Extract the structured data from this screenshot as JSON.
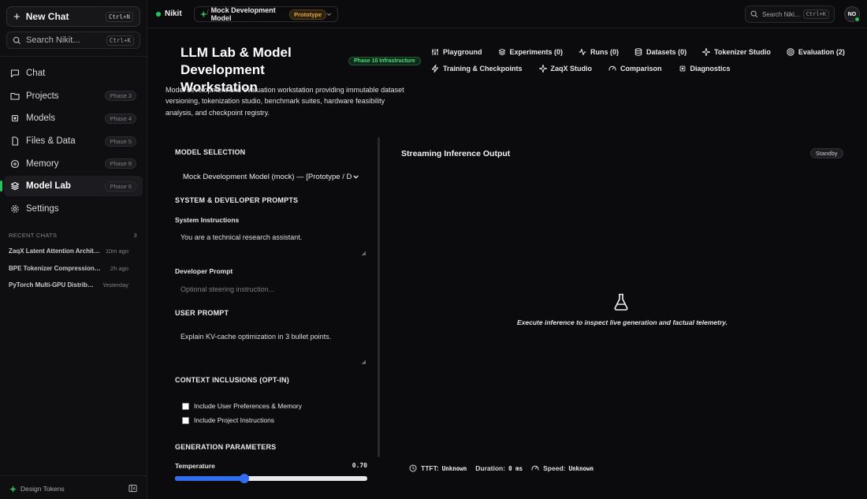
{
  "sidebar": {
    "new_chat": "New Chat",
    "new_chat_kbd": "Ctrl+N",
    "search": "Search Nikit...",
    "search_kbd": "Ctrl+K",
    "items": [
      {
        "label": "Chat",
        "icon": "chat-icon",
        "phase": ""
      },
      {
        "label": "Projects",
        "icon": "folder-icon",
        "phase": "Phase 3"
      },
      {
        "label": "Models",
        "icon": "chip-icon",
        "phase": "Phase 4"
      },
      {
        "label": "Files & Data",
        "icon": "file-icon",
        "phase": "Phase 5"
      },
      {
        "label": "Memory",
        "icon": "memory-icon",
        "phase": "Phase 8"
      },
      {
        "label": "Model Lab",
        "icon": "layers-icon",
        "phase": "Phase 6",
        "active": true
      },
      {
        "label": "Settings",
        "icon": "gear-icon",
        "phase": ""
      }
    ],
    "recent_label": "RECENT CHATS",
    "recent_count": "3",
    "recent": [
      {
        "title": "ZaqX Latent Attention Architecture",
        "time": "10m ago"
      },
      {
        "title": "BPE Tokenizer Compression Experiments",
        "time": "2h ago"
      },
      {
        "title": "PyTorch Multi-GPU Distributed Training",
        "time": "Yesterday"
      }
    ],
    "design_tokens": "Design Tokens"
  },
  "topbar": {
    "workspace": "Nikit",
    "separator": "/",
    "model_name": "Mock Development Model",
    "model_badge": "Prototype",
    "search": "Search Niki...",
    "search_kbd": "Ctrl+K",
    "avatar": "NO"
  },
  "header": {
    "title": "LLM Lab & Model Development Workstation",
    "phase_badge": "Phase 10 Infrastructure",
    "description": "Model development and evaluation workstation providing immutable dataset versioning, tokenization studio, benchmark suites, hardware feasibility analysis, and checkpoint registry."
  },
  "tabs_row1": [
    {
      "label": "Playground",
      "icon": "sliders-icon"
    },
    {
      "label": "Experiments (0)",
      "icon": "layers-icon"
    },
    {
      "label": "Runs (0)",
      "icon": "activity-icon"
    },
    {
      "label": "Datasets (0)",
      "icon": "database-icon"
    },
    {
      "label": "Tokenizer Studio",
      "icon": "sparkle-icon"
    },
    {
      "label": "Evaluation (2)",
      "icon": "target-icon"
    }
  ],
  "tabs_row2": [
    {
      "label": "Training & Checkpoints",
      "icon": "zap-icon"
    },
    {
      "label": "ZaqX Studio",
      "icon": "sparkle-icon"
    },
    {
      "label": "Comparison",
      "icon": "gauge-icon"
    },
    {
      "label": "Diagnostics",
      "icon": "chip-icon"
    }
  ],
  "form": {
    "model_selection": "MODEL SELECTION",
    "model_value": "Mock Development Model (mock) — [Prototype / D",
    "prompts_header": "SYSTEM & DEVELOPER PROMPTS",
    "system_label": "System Instructions",
    "system_value": "You are a technical research assistant.",
    "developer_label": "Developer Prompt",
    "developer_placeholder": "Optional steering instruction...",
    "user_prompt_header": "USER PROMPT",
    "user_prompt_value": "Explain KV-cache optimization in 3 bullet points.",
    "context_header": "CONTEXT INCLUSIONS (OPT-IN)",
    "include_prefs": "Include User Preferences & Memory",
    "include_project": "Include Project Instructions",
    "gen_header": "GENERATION PARAMETERS",
    "temperature_label": "Temperature",
    "temperature_value": "0.70",
    "temperature_fraction": 0.36
  },
  "output": {
    "title": "Streaming Inference Output",
    "status": "Standby",
    "empty_message": "Execute inference to inspect live generation and factual telemetry.",
    "ttft_label": "TTFT:",
    "ttft_value": "Unknown",
    "duration_label": "Duration:",
    "duration_value": "0 ms",
    "speed_label": "Speed:",
    "speed_value": "Unknown"
  },
  "colors": {
    "accent": "#22c55e",
    "slider": "#2f6fed",
    "prototype": "#e8a53b"
  }
}
